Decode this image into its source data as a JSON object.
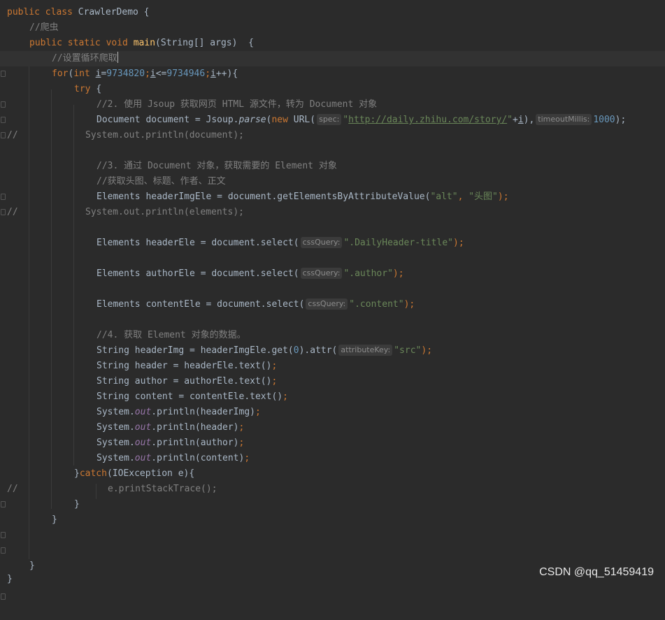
{
  "editor": {
    "background": "#2b2b2b",
    "keyword_color": "#cc7832",
    "string_color": "#6a8759",
    "number_color": "#6897bb",
    "comment_color": "#808080",
    "method_color": "#ffc66d",
    "static_field_color": "#9876aa"
  },
  "code": {
    "l1_kw": "public class ",
    "l1_name": "CrawlerDemo {",
    "l2_comment": "//爬虫",
    "l3_kw": "public static void ",
    "l3_fn": "main",
    "l3_rest": "(String[] args)  {",
    "l4_comment": "//设置循环爬取",
    "l5_for": "for",
    "l5_open": "(",
    "l5_int": "int ",
    "l5_i1": "i",
    "l5_eq": "=",
    "l5_start": "9734820",
    "l5_semi1": ";",
    "l5_i2": "i",
    "l5_le": "<=",
    "l5_end": "9734946",
    "l5_semi2": ";",
    "l5_i3": "i",
    "l5_close": "++){",
    "l6_try": "try ",
    "l6_brace": "{",
    "l7_comment": "//2. 使用 Jsoup 获取网页 HTML 源文件，转为 Document 对象",
    "l8_a": "Document document = Jsoup.",
    "l8_parse": "parse",
    "l8_b": "(",
    "l8_new": "new ",
    "l8_c": "URL(",
    "l8_hint_spec": "spec:",
    "l8_q1": "\"",
    "l8_url": "http://daily.zhihu.com/story/",
    "l8_q2": "\"",
    "l8_plus": "+",
    "l8_i": "i",
    "l8_d": "),",
    "l8_hint_timeout": "timeoutMillis:",
    "l8_timeout": "1000",
    "l8_e": ");",
    "l9_prefix": "//",
    "l9_code": "System.out.println(document);",
    "l11_comment": "//3. 通过 Document 对象，获取需要的 Element 对象",
    "l12_comment": "//获取头图、标题、作者、正文",
    "l13_a": "Elements headerImgEle = document.getElementsByAttributeValue(",
    "l13_s1": "\"alt\"",
    "l13_comma": ", ",
    "l13_s2": "\"头图\"",
    "l13_e": ");",
    "l14_prefix": "//",
    "l14_code": "System.out.println(elements);",
    "l16_a": "Elements headerEle = document.select(",
    "l16_hint": "cssQuery:",
    "l16_s": "\".DailyHeader-title\"",
    "l16_e": ");",
    "l18_a": "Elements authorEle = document.select(",
    "l18_hint": "cssQuery:",
    "l18_s": "\".author\"",
    "l18_e": ");",
    "l20_a": "Elements contentEle = document.select(",
    "l20_hint": "cssQuery:",
    "l20_s": "\".content\"",
    "l20_e": ");",
    "l22_comment": "//4. 获取 Element 对象的数据。",
    "l23_a": "String headerImg = headerImgEle.get(",
    "l23_n": "0",
    "l23_b": ").attr(",
    "l23_hint": "attributeKey:",
    "l23_s": "\"src\"",
    "l23_e": ");",
    "l24_a": "String header = headerEle.text()",
    "l24_e": ";",
    "l25_a": "String author = authorEle.text()",
    "l25_e": ";",
    "l26_a": "String content = contentEle.text()",
    "l26_e": ";",
    "sys": "System.",
    "out": "out",
    "l27_b": ".println(headerImg)",
    "l28_b": ".println(header)",
    "l29_b": ".println(author)",
    "l30_b": ".println(content)",
    "semi": ";",
    "l31_a": "}",
    "l31_catch": "catch",
    "l31_b": "(IOException e){",
    "l32_prefix": "//",
    "l32_code": "e.printStackTrace();",
    "l33": "}",
    "l34": "}",
    "l37": "}",
    "l38": "}"
  },
  "watermark": "CSDN @qq_51459419"
}
